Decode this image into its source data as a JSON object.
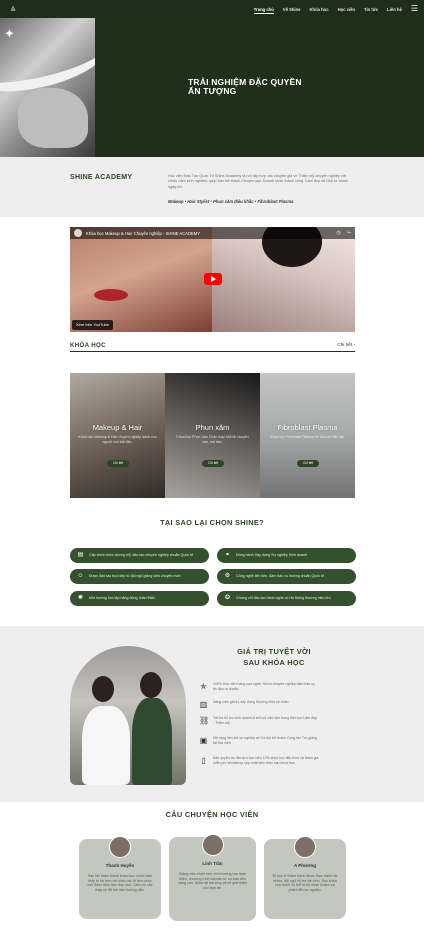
{
  "colors": {
    "brand_dark": "#1f2d1b",
    "brand_green": "#35502f",
    "section_gray": "#eeeeee",
    "heading_green": "#2c4325"
  },
  "nav": {
    "logo_text": "SHINE",
    "items": [
      "Trang chủ",
      "Về Shine",
      "Khóa học",
      "Học viên",
      "Tin tức",
      "Liên hệ"
    ],
    "active": "Trang chủ",
    "menu_icon": "hamburger-icon"
  },
  "hero": {
    "title_line1": "TRẢI NGHIỆM ĐẶC QUYỀN",
    "title_line2": "ẤN TƯỢNG",
    "sparkle_icon": "sparkle-icon"
  },
  "academy": {
    "title": "SHINE ACADEMY",
    "description": "Học viện Đào Tạo Quốc Tế Shine Academy là nơi tập hợp các chuyên gia về Thẩm mỹ chuyên nghiệp với nhiều năm kinh nghiệm, giúp bạn trở thành Chuyên gia, Doanh nhân thành công. Làm đẹp sẽ Giỏi từ nhóm ngày tới.",
    "tags": "Makeup • Hair Stylist • Phun xăm điêu khắc • Fibroblast Plasma"
  },
  "video": {
    "title": "Khóa học Makeup & Hair Chuyên nghiệp - SHINE ACADEMY",
    "share": "Share",
    "watch_later": "Watch later",
    "badge": "Xem trên YouTube"
  },
  "courses": {
    "title": "KHÓA HỌC",
    "more": "Chi tiết",
    "items": [
      {
        "title": "Makeup & Hair",
        "desc": "Khóa học Makeup & Hair chuyên nghiệp dành cho người mới bắt đầu.",
        "btn": "Chi tiết"
      },
      {
        "title": "Phun xăm",
        "desc": "Khóa học Phun xăm Chân mày Môi Mí chuyên sâu, bài bản.",
        "btn": "Chi tiết"
      },
      {
        "title": "Fibroblast Plasma",
        "desc": "Khóa học Fibroblast Plasma trẻ hóa da hiện đại.",
        "btn": "Chi tiết"
      }
    ]
  },
  "why": {
    "title": "TẠI SAO LẠI CHỌN SHINE?",
    "items": [
      {
        "icon": "certificate-icon",
        "text": "Cấp chính thức chứng chỉ, đào tạo chuyên nghiệp chuẩn Quốc tế"
      },
      {
        "icon": "handshake-icon",
        "text": "Đồng hành Xây dựng Sự nghiệp Kinh doanh"
      },
      {
        "icon": "teacher-icon",
        "text": "Được đào tạo trực tiếp từ đội ngũ giảng viên chuyên môn"
      },
      {
        "icon": "tools-icon",
        "text": "Công nghệ tiên tiến, đảm bảo xu hướng chuẩn Quốc tế"
      },
      {
        "icon": "bulb-icon",
        "text": "Môi trường học tập năng động, thân thiện"
      },
      {
        "icon": "medal-icon",
        "text": "Chứng chỉ đào tạo hành nghề có Hệ thống thương hiệu lớn"
      }
    ]
  },
  "value": {
    "title_line1": "GIÁ TRỊ TUYỆT VỜI",
    "title_line2": "SAU KHÓA HỌC",
    "items": [
      {
        "icon": "star-icon",
        "text": "100% Học viên nâng cao nghề, hỗ trợ chuyên nghiệp đảm bảo uy tín đầu ra chuẩn."
      },
      {
        "icon": "chart-icon",
        "text": "Nâng cấm giá trị, xây dựng thương hiệu cá nhân."
      },
      {
        "icon": "link-icon",
        "text": "Tài trợ hỗ trợ kinh doanh & kết nối việc làm trong lĩnh vực Làm đẹp - Thẩm mỹ."
      },
      {
        "icon": "briefcase-icon",
        "text": "Mở rộng liên kết sự nghiệp và Cơ hội trở thành Cộng tác Trợ giảng tại học viện."
      },
      {
        "icon": "book-icon",
        "text": "Đặc quyền ưu đãi cựu học viên 10% khóa học tiếp theo và tham gia miễn phí Workshop cập nhật kiến thức sau khóa học."
      }
    ]
  },
  "stories": {
    "title": "CÂU CHUYỆN HỌC VIÊN",
    "items": [
      {
        "name": "Thanh Huyền",
        "quote": "Sau khi hoàn thành khóa học, mình cảm thấy tự tin hơn rất nhiều khi đi làm và tự mở được tiệm làm đẹp nhỏ. Cảm ơn các thầy cô đã tận tâm hướng dẫn."
      },
      {
        "name": "Linh Trần",
        "quote": "Giảng viên nhiệt tình, môi trường học thân thiện, chương trình bài bản từ cơ bản đến nâng cao. Mình rất hài lòng và sẽ giới thiệu cho bạn bè."
      },
      {
        "name": "A Phương",
        "quote": "Đi học ở Shine mình được thực hành rất nhiều, đội ngũ hỗ trợ tận tình. Sau khóa học mình có thể tự tin nhận khách và phát triển sự nghiệp."
      }
    ]
  }
}
